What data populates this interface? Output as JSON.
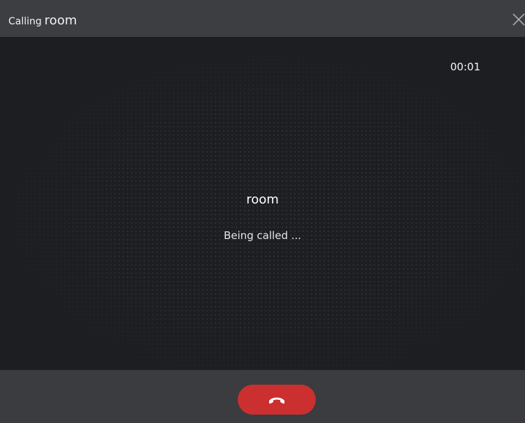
{
  "window": {
    "title_prefix": "Calling",
    "title_name": "room",
    "close_icon": "close-icon"
  },
  "call": {
    "timer": "00:01",
    "callee_name": "room",
    "status_text": "Being called ..."
  },
  "controls": {
    "hangup_icon": "phone-hangup-icon",
    "hangup_color": "#cc2f2f"
  },
  "colors": {
    "titlebar": "#3c3e42",
    "background": "#1c1e22",
    "control_bar": "#3a3c40"
  }
}
